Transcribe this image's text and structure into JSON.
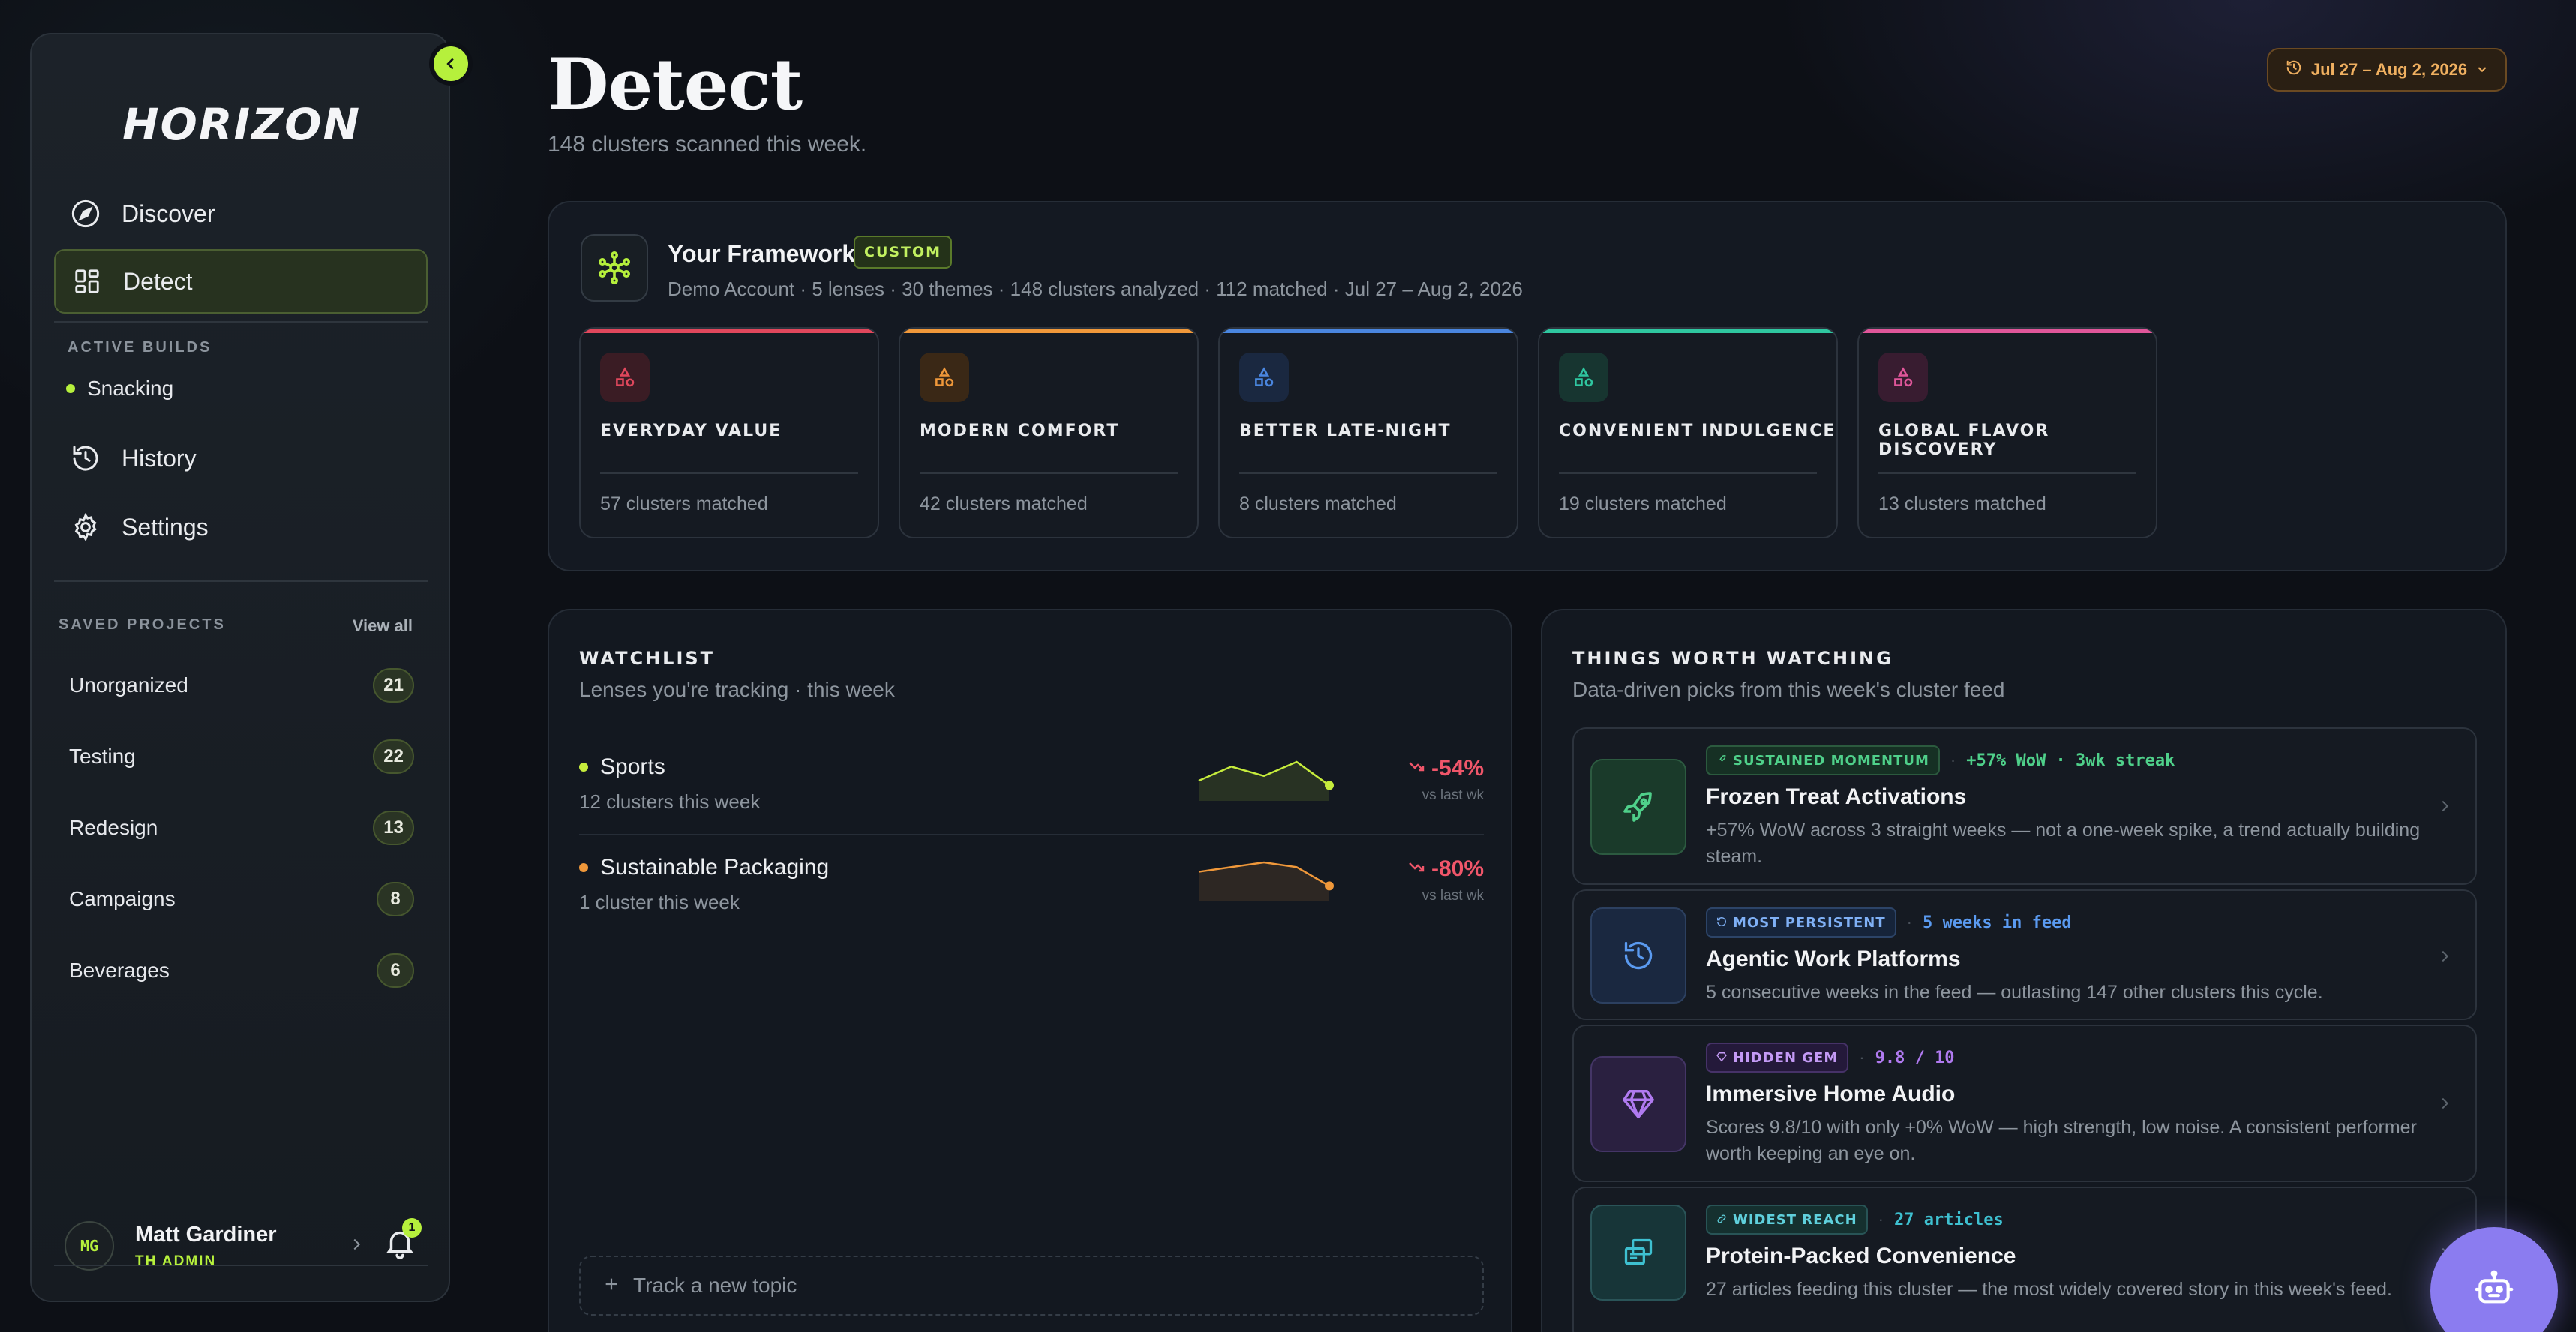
{
  "app": {
    "logo": "HORIZON"
  },
  "nav": {
    "items": [
      {
        "label": "Discover",
        "icon": "compass-icon"
      },
      {
        "label": "Detect",
        "icon": "dashboard-grid-icon",
        "active": true
      },
      {
        "label": "History",
        "icon": "history-icon"
      },
      {
        "label": "Settings",
        "icon": "gear-icon"
      }
    ],
    "active_builds_label": "ACTIVE BUILDS",
    "active_builds": [
      {
        "label": "Snacking",
        "color": "#b6f03c"
      }
    ]
  },
  "projects": {
    "label": "SAVED PROJECTS",
    "view_all": "View all",
    "items": [
      {
        "name": "Unorganized",
        "count": "21"
      },
      {
        "name": "Testing",
        "count": "22"
      },
      {
        "name": "Redesign",
        "count": "13"
      },
      {
        "name": "Campaigns",
        "count": "8"
      },
      {
        "name": "Beverages",
        "count": "6"
      }
    ]
  },
  "user": {
    "initials": "MG",
    "name": "Matt Gardiner",
    "role": "TH ADMIN",
    "notifications": "1"
  },
  "header": {
    "title": "Detect",
    "subtitle": "148 clusters scanned this week.",
    "date_range": "Jul 27 – Aug 2, 2026"
  },
  "framework": {
    "title": "Your Framework",
    "tag": "CUSTOM",
    "meta": "Demo Account · 5 lenses · 30 themes · 148 clusters analyzed · 112 matched · Jul 27 – Aug 2, 2026",
    "lenses": [
      {
        "name": "EVERYDAY VALUE",
        "count": "57 clusters matched",
        "color": "#e0475c"
      },
      {
        "name": "MODERN COMFORT",
        "count": "42 clusters matched",
        "color": "#f0983a"
      },
      {
        "name": "BETTER LATE-NIGHT",
        "count": "8 clusters matched",
        "color": "#4a86e0"
      },
      {
        "name": "CONVENIENT INDULGENCE",
        "count": "19 clusters matched",
        "color": "#2fc7a0"
      },
      {
        "name": "GLOBAL FLAVOR DISCOVERY",
        "count": "13 clusters matched",
        "color": "#e0569a"
      }
    ]
  },
  "watchlist": {
    "heading": "WATCHLIST",
    "subheading": "Lenses you're tracking · this week",
    "items": [
      {
        "name": "Sports",
        "sub": "12 clusters this week",
        "change": "-54%",
        "vs": "vs last wk",
        "color": "#c6ec3c",
        "trend": [
          3,
          6,
          4,
          7,
          2
        ]
      },
      {
        "name": "Sustainable Packaging",
        "sub": "1 cluster this week",
        "change": "-80%",
        "vs": "vs last wk",
        "color": "#f0983a",
        "trend": [
          5,
          6,
          7,
          6,
          2
        ]
      }
    ],
    "track_label": "Track a new topic"
  },
  "worth": {
    "heading": "THINGS WORTH WATCHING",
    "subheading": "Data-driven picks from this week's cluster feed",
    "items": [
      {
        "tag": "SUSTAINED MOMENTUM",
        "meta": "+57% WoW · 3wk streak",
        "title": "Frozen Treat Activations",
        "desc": "+57% WoW across 3 straight weeks — not a one-week spike, a trend actually building steam.",
        "icon": "rocket-icon",
        "color": "#4fd08a"
      },
      {
        "tag": "MOST PERSISTENT",
        "meta": "5 weeks in feed",
        "title": "Agentic Work Platforms",
        "desc": "5 consecutive weeks in the feed — outlasting 147 other clusters this cycle.",
        "icon": "history-icon",
        "color": "#5a9af0"
      },
      {
        "tag": "HIDDEN GEM",
        "meta": "9.8 / 10",
        "title": "Immersive Home Audio",
        "desc": "Scores 9.8/10 with only +0% WoW — high strength, low noise. A consistent performer worth keeping an eye on.",
        "icon": "gem-icon",
        "color": "#b07af0"
      },
      {
        "tag": "WIDEST REACH",
        "meta": "27 articles",
        "title": "Protein-Packed Convenience",
        "desc": "27 articles feeding this cluster — the most widely covered story in this week's feed.",
        "icon": "articles-icon",
        "color": "#3ec0d0"
      }
    ]
  }
}
